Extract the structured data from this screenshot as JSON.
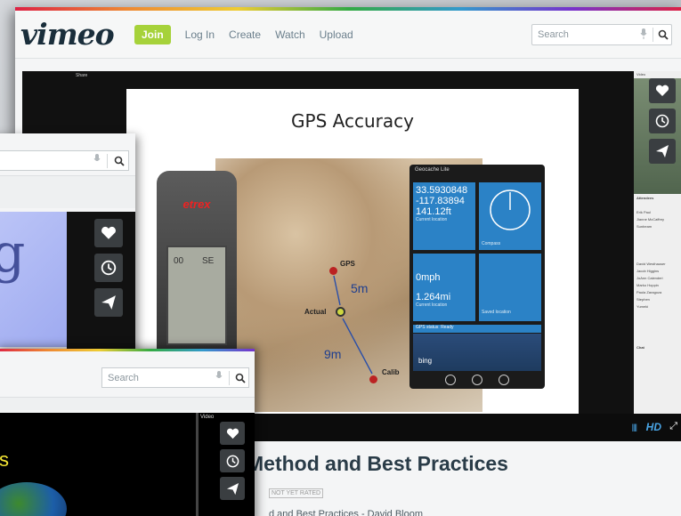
{
  "main_window": {
    "logo": "vimeo",
    "nav": {
      "join": "Join",
      "login": "Log In",
      "create": "Create",
      "watch": "Watch",
      "upload": "Upload"
    },
    "search_placeholder": "Search",
    "player": {
      "share_bar": "Share",
      "slide_title": "GPS Accuracy",
      "device_brand": "etrex",
      "device_screen_values": [
        "00",
        "SE"
      ],
      "map_labels": {
        "gps": "GPS",
        "actual": "Actual",
        "calib": "Calib"
      },
      "distances": [
        "5m",
        "9m"
      ],
      "phone_app": {
        "header": "Geocache Lite",
        "latitude": "33.5930848",
        "longitude": "-117.83894",
        "altitude": "141.12ft",
        "current_location": "Current location",
        "compass": "Compass",
        "speed": "0mph",
        "distance": "1.264mi",
        "saved_location": "Saved location",
        "status": "GPS status: Ready",
        "bing": "bing"
      },
      "side_panel": {
        "video": "Video",
        "attendees": "Attendees",
        "chat": "Chat",
        "names": [
          "Erik Paul",
          "Jianne McCaffrey",
          "Sunbeam",
          "David Westhauser",
          "Jacob Higgins",
          "JoAnn Calenderi",
          "Marko Hoppin",
          "Paula Zaragoza",
          "Stephen",
          "Yumeki"
        ]
      },
      "hd_label": "HD"
    },
    "video_title": "Method and Best Practices",
    "rating_badge": "NOT YET RATED",
    "video_subtitle": "d and Best Practices - David Bloom"
  },
  "middle_window": {
    "glyph": "g"
  },
  "bottom_window": {
    "search_placeholder": "Search",
    "video_label": "Video",
    "yellow_text": "s"
  },
  "colors": {
    "join_green": "#a6d23a",
    "vimeo_navy": "#1a2e3b",
    "hd_blue": "#49a5e6",
    "tile_blue": "#2b82c6"
  },
  "icons": [
    "heart-icon",
    "clock-icon",
    "send-icon",
    "search-icon",
    "microphone-icon",
    "fullscreen-icon"
  ]
}
